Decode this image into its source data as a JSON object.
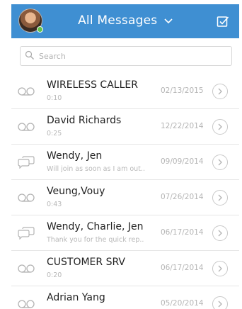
{
  "header": {
    "title": "All Messages",
    "accent_color": "#3f8fd2",
    "presence_status": "online"
  },
  "search": {
    "placeholder": "Search"
  },
  "conversations": [
    {
      "name": "WIRELESS CALLER",
      "sub": "0:10",
      "date": "02/13/2015",
      "type": "voicemail"
    },
    {
      "name": "David Richards",
      "sub": "0:25",
      "date": "12/22/2014",
      "type": "voicemail"
    },
    {
      "name": "Wendy, Jen",
      "sub": "Will join as soon as I am out..",
      "date": "09/09/2014",
      "type": "chat"
    },
    {
      "name": "Veung,Vouy",
      "sub": "0:43",
      "date": "07/26/2014",
      "type": "voicemail"
    },
    {
      "name": "Wendy, Charlie, Jen",
      "sub": "Thank you for the quick rep..",
      "date": "06/17/2014",
      "type": "chat"
    },
    {
      "name": "CUSTOMER SRV",
      "sub": "0:20",
      "date": "06/17/2014",
      "type": "voicemail"
    },
    {
      "name": "Adrian Yang",
      "sub": "",
      "date": "05/20/2014",
      "type": "voicemail"
    }
  ]
}
